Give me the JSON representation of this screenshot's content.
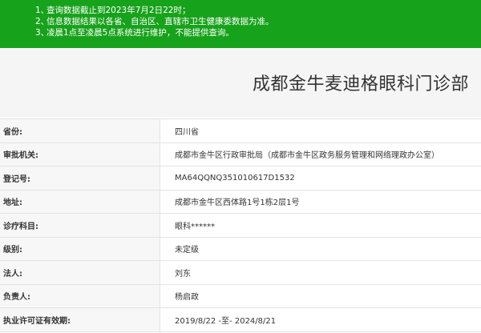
{
  "notice": {
    "lines": [
      {
        "num": "1、",
        "text": "查询数据截止到2023年7月2日22时；"
      },
      {
        "num": "2、",
        "text": "信息数据结果以各省、自治区、直辖市卫生健康委数据为准。"
      },
      {
        "num": "3、",
        "text": "凌晨1点至凌晨5点系统进行维护，不能提供查询。"
      }
    ]
  },
  "title": "成都金牛麦迪格眼科门诊部",
  "rows": [
    {
      "label": "省份:",
      "value": "四川省"
    },
    {
      "label": "审批机关:",
      "value": "成都市金牛区行政审批局（成都市金牛区政务服务管理和网络理政办公室）"
    },
    {
      "label": "登记号:",
      "value": "MA64QQNQ351010617D1532"
    },
    {
      "label": "地址:",
      "value": "成都市金牛区西体路1号1栋2层1号"
    },
    {
      "label": "诊疗科目:",
      "value": "眼科******"
    },
    {
      "label": "级别:",
      "value": "未定级"
    },
    {
      "label": "法人:",
      "value": "刘东"
    },
    {
      "label": "负责人:",
      "value": "杨启政"
    },
    {
      "label": "执业许可证有效期:",
      "value": "2019/8/22 -至- 2024/8/21"
    }
  ]
}
